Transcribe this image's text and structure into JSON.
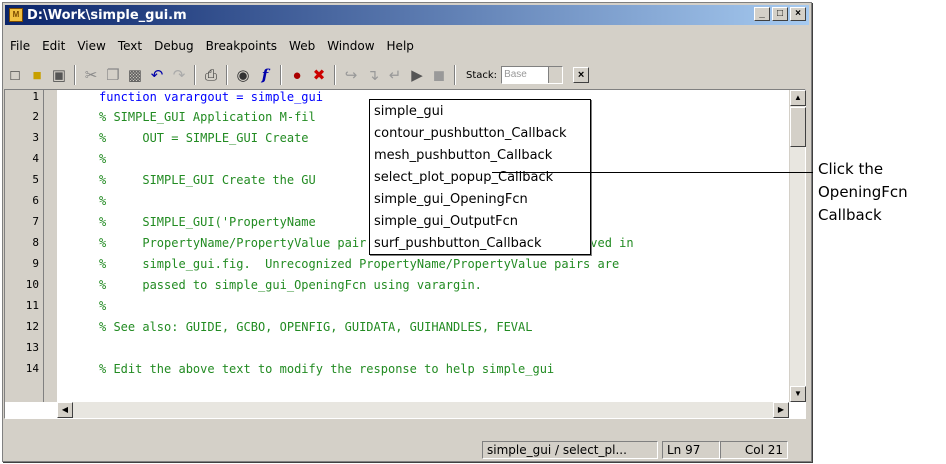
{
  "window": {
    "title": "D:\\Work\\simple_gui.m",
    "buttons": {
      "minimize": "_",
      "maximize": "□",
      "close": "×"
    }
  },
  "menu": [
    "File",
    "Edit",
    "View",
    "Text",
    "Debug",
    "Breakpoints",
    "Web",
    "Window",
    "Help"
  ],
  "toolbar": {
    "icons": [
      "new-file-icon",
      "open-folder-icon",
      "save-icon",
      "cut-icon",
      "copy-icon",
      "paste-icon",
      "undo-icon",
      "redo-icon",
      "print-icon",
      "find-icon",
      "function-icon",
      "breakpoint-set-icon",
      "breakpoint-clear-icon",
      "step-icon",
      "step-in-icon",
      "step-out-icon",
      "continue-icon",
      "exit-debug-icon"
    ],
    "stack_label": "Stack:",
    "stack_value": "Base"
  },
  "editor": {
    "line_numbers": [
      "1",
      "2",
      "3",
      "4",
      "5",
      "6",
      "7",
      "8",
      "9",
      "10",
      "11",
      "12",
      "13",
      "14"
    ],
    "lines": [
      "function varargout = simple_gui",
      "% SIMPLE_GUI Application M-fil",
      "%     OUT = SIMPLE_GUI Create                           arguments.",
      "%",
      "%     SIMPLE_GUI Create the GU                         s.",
      "%",
      "%     SIMPLE_GUI('PropertyName                        ,value2)",
      "%     PropertyName/PropertyValue pair arguments override defaults saved in",
      "%     simple_gui.fig.  Unrecognized PropertyName/PropertyValue pairs are",
      "%     passed to simple_gui_OpeningFcn using varargin.",
      "%",
      "% See also: GUIDE, GCBO, OPENFIG, GUIDATA, GUIHANDLES, FEVAL",
      "",
      "% Edit the above text to modify the response to help simple_gui"
    ]
  },
  "function_popup": {
    "items": [
      "simple_gui",
      "contour_pushbutton_Callback",
      "mesh_pushbutton_Callback",
      "select_plot_popup_Callback",
      "simple_gui_OpeningFcn",
      "simple_gui_OutputFcn",
      "surf_pushbutton_Callback"
    ]
  },
  "status": {
    "context": "simple_gui / select_pl...",
    "line": "Ln 97",
    "col": "Col 21"
  },
  "annotation": {
    "line1": "Click the",
    "line2": "OpeningFcn",
    "line3": "Callback"
  }
}
